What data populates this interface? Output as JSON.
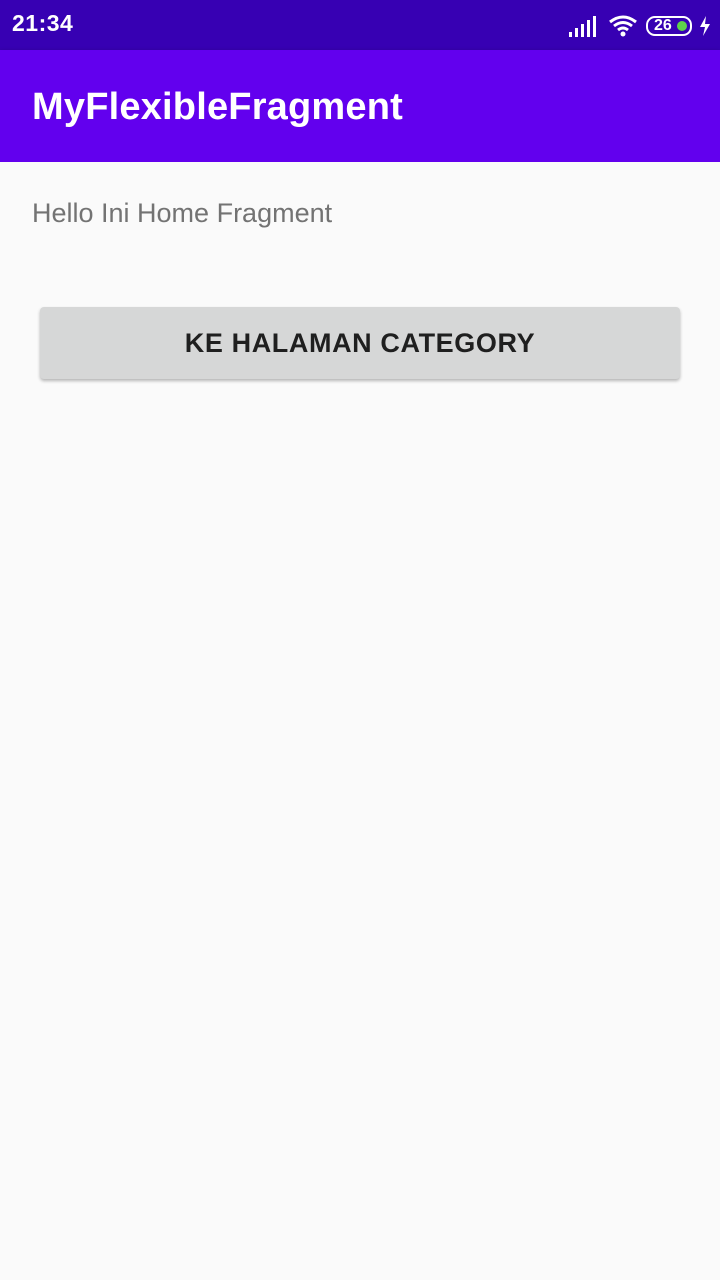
{
  "status_bar": {
    "time": "21:34",
    "battery_level": "26",
    "icons": [
      "signal-icon",
      "wifi-icon",
      "battery-icon",
      "charging-icon"
    ],
    "background": "#3700b3"
  },
  "app_bar": {
    "title": "MyFlexibleFragment",
    "background": "#6200ee"
  },
  "home_fragment": {
    "message": "Hello Ini Home Fragment",
    "button_label": "KE HALAMAN CATEGORY",
    "button_color": "#d6d7d7"
  }
}
